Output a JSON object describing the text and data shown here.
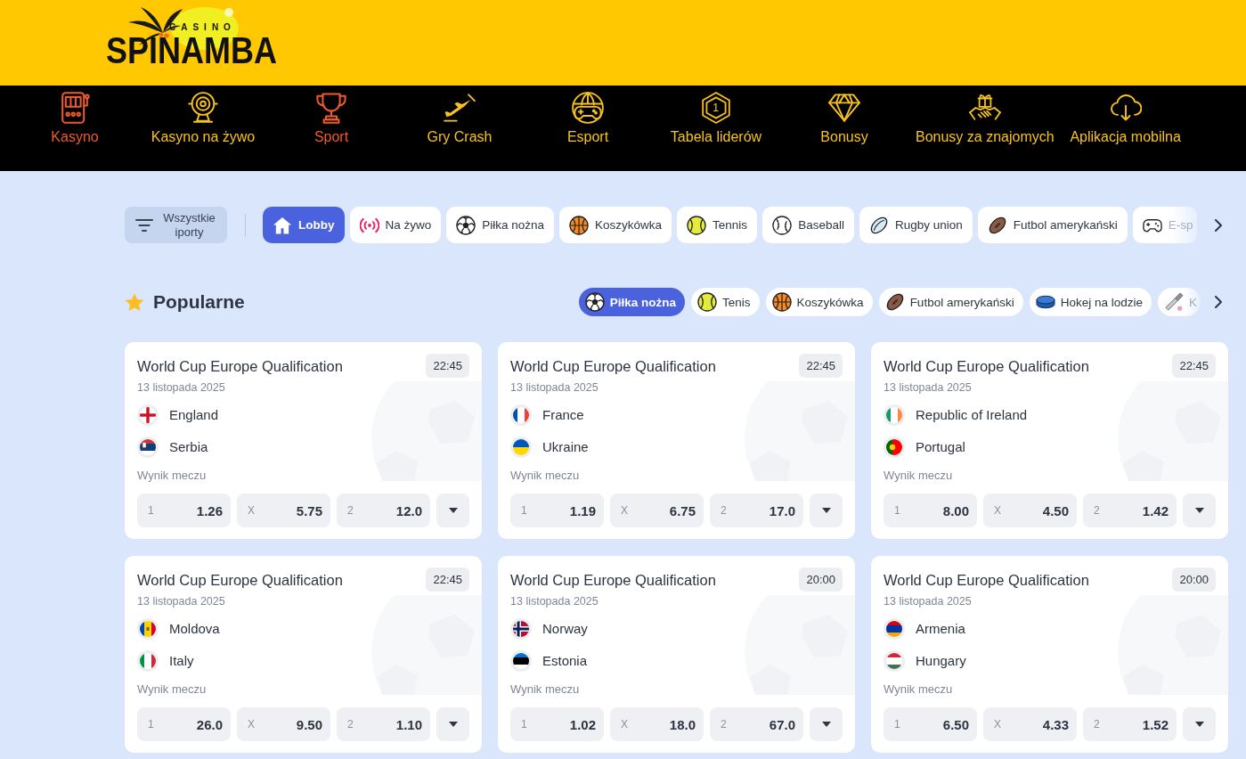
{
  "header": {
    "logo": {
      "tagline": "CASINO",
      "name": "SPINAMBA"
    }
  },
  "nav": [
    {
      "label": "Kasyno",
      "color": "#f05a2a"
    },
    {
      "label": "Kasyno na żywo",
      "color": "#f7c21e"
    },
    {
      "label": "Sport",
      "color": "#f05a2a"
    },
    {
      "label": "Gry Crash",
      "color": "#f7c21e"
    },
    {
      "label": "Esport",
      "color": "#f7c21e"
    },
    {
      "label": "Tabela liderów",
      "color": "#f7c21e",
      "badge": "1"
    },
    {
      "label": "Bonusy",
      "color": "#f7c21e"
    },
    {
      "label": "Bonusy za znajomych",
      "color": "#f7c21e"
    },
    {
      "label": "Aplikacja mobilna",
      "color": "#f7c21e"
    }
  ],
  "sports_bar": {
    "filter_button": "Wszystkie iporty",
    "chips": [
      {
        "label": "Lobby",
        "selected": true
      },
      {
        "label": "Na żywo",
        "selected": false
      },
      {
        "label": "Piłka nożna",
        "selected": false
      },
      {
        "label": "Koszykówka",
        "selected": false
      },
      {
        "label": "Tennis",
        "selected": false
      },
      {
        "label": "Baseball",
        "selected": false
      },
      {
        "label": "Rugby union",
        "selected": false
      },
      {
        "label": "Futbol amerykański",
        "selected": false
      },
      {
        "label": "E-sp",
        "selected": false
      }
    ]
  },
  "popular": {
    "title": "Popularne",
    "chips": [
      {
        "label": "Piłka nożna",
        "selected": true
      },
      {
        "label": "Tenis",
        "selected": false
      },
      {
        "label": "Koszykówka",
        "selected": false
      },
      {
        "label": "Futbol amerykański",
        "selected": false
      },
      {
        "label": "Hokej na lodzie",
        "selected": false
      },
      {
        "label": "K",
        "selected": false
      }
    ]
  },
  "matches": [
    {
      "competition": "World Cup Europe Qualification",
      "date": "13 listopada 2025",
      "time": "22:45",
      "teams": [
        "England",
        "Serbia"
      ],
      "market": "Wynik meczu",
      "odds": [
        {
          "label": "1",
          "value": "1.26"
        },
        {
          "label": "X",
          "value": "5.75"
        },
        {
          "label": "2",
          "value": "12.0"
        }
      ]
    },
    {
      "competition": "World Cup Europe Qualification",
      "date": "13 listopada 2025",
      "time": "22:45",
      "teams": [
        "France",
        "Ukraine"
      ],
      "market": "Wynik meczu",
      "odds": [
        {
          "label": "1",
          "value": "1.19"
        },
        {
          "label": "X",
          "value": "6.75"
        },
        {
          "label": "2",
          "value": "17.0"
        }
      ]
    },
    {
      "competition": "World Cup Europe Qualification",
      "date": "13 listopada 2025",
      "time": "22:45",
      "teams": [
        "Republic of Ireland",
        "Portugal"
      ],
      "market": "Wynik meczu",
      "odds": [
        {
          "label": "1",
          "value": "8.00"
        },
        {
          "label": "X",
          "value": "4.50"
        },
        {
          "label": "2",
          "value": "1.42"
        }
      ]
    },
    {
      "competition": "World Cup Europe Qualification",
      "date": "13 listopada 2025",
      "time": "22:45",
      "teams": [
        "Moldova",
        "Italy"
      ],
      "market": "Wynik meczu",
      "odds": [
        {
          "label": "1",
          "value": "26.0"
        },
        {
          "label": "X",
          "value": "9.50"
        },
        {
          "label": "2",
          "value": "1.10"
        }
      ]
    },
    {
      "competition": "World Cup Europe Qualification",
      "date": "13 listopada 2025",
      "time": "20:00",
      "teams": [
        "Norway",
        "Estonia"
      ],
      "market": "Wynik meczu",
      "odds": [
        {
          "label": "1",
          "value": "1.02"
        },
        {
          "label": "X",
          "value": "18.0"
        },
        {
          "label": "2",
          "value": "67.0"
        }
      ]
    },
    {
      "competition": "World Cup Europe Qualification",
      "date": "13 listopada 2025",
      "time": "20:00",
      "teams": [
        "Armenia",
        "Hungary"
      ],
      "market": "Wynik meczu",
      "odds": [
        {
          "label": "1",
          "value": "6.50"
        },
        {
          "label": "X",
          "value": "4.33"
        },
        {
          "label": "2",
          "value": "1.52"
        }
      ]
    }
  ]
}
